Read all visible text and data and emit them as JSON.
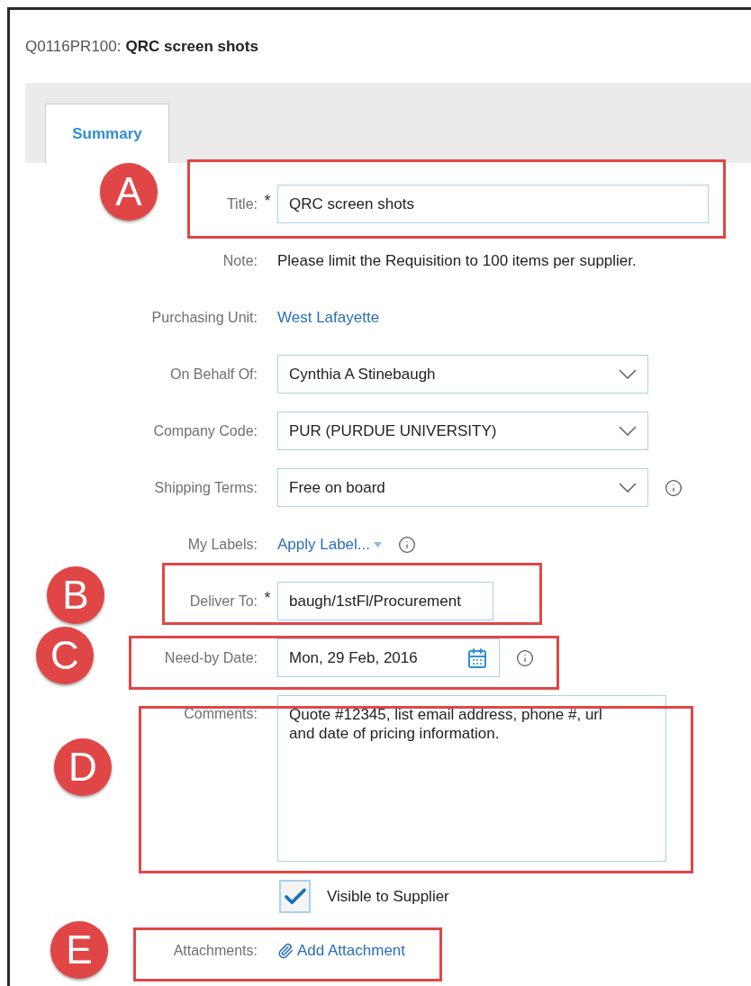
{
  "header": {
    "id": "Q0116PR100:",
    "title": "QRC screen shots"
  },
  "tabs": [
    {
      "label": "Summary",
      "selected": true
    }
  ],
  "fields": [
    {
      "kind": "text",
      "label": "Title:",
      "marker": "*",
      "value": "QRC screen shots"
    },
    {
      "kind": "note",
      "label": "Note:",
      "value": "Please limit the Requisition to 100 items per supplier."
    },
    {
      "kind": "link",
      "label": "Purchasing Unit:",
      "value": "West Lafayette"
    },
    {
      "kind": "select",
      "label": "On Behalf Of:",
      "value": "Cynthia A Stinebaugh"
    },
    {
      "kind": "select",
      "label": "Company Code:",
      "value": "PUR (PURDUE UNIVERSITY)"
    },
    {
      "kind": "select",
      "label": "Shipping Terms:",
      "value": "Free on board",
      "info": true
    },
    {
      "kind": "labels",
      "label": "My Labels:",
      "value": "Apply Label...",
      "info": true
    },
    {
      "kind": "short",
      "label": "Deliver To:",
      "marker": "*",
      "value": "baugh/1stFl/Procurement"
    },
    {
      "kind": "date",
      "label": "Need-by Date:",
      "value": "Mon, 29 Feb, 2016",
      "info": true
    },
    {
      "kind": "textarea",
      "label": "Comments:",
      "value": "Quote #12345, list email address, phone #, url and date of pricing information."
    },
    {
      "kind": "checkbox",
      "label": "Visible to Supplier",
      "checked": true
    },
    {
      "kind": "attachment",
      "label": "Attachments:",
      "value": "Add Attachment"
    }
  ],
  "callouts": [
    {
      "letter": "A"
    },
    {
      "letter": "B"
    },
    {
      "letter": "C"
    },
    {
      "letter": "D"
    },
    {
      "letter": "E"
    }
  ]
}
